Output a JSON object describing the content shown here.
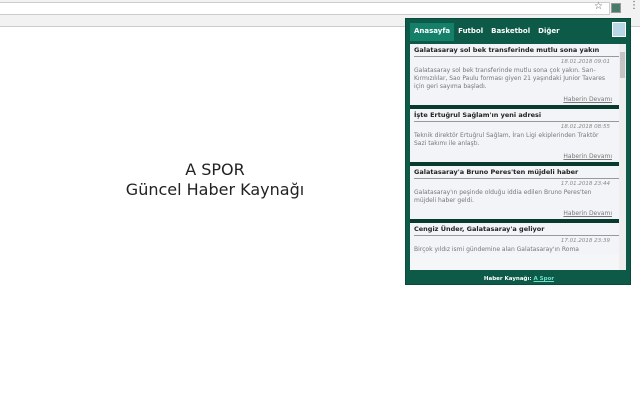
{
  "page": {
    "line1": "A SPOR",
    "line2": "Güncel Haber Kaynağı"
  },
  "popup": {
    "tabs": [
      "Anasayfa",
      "Futbol",
      "Basketbol",
      "Diğer"
    ],
    "articles": [
      {
        "title": "Galatasaray sol bek transferinde mutlu sona yakın",
        "date": "18.01.2018 09:01",
        "text": "Galatasaray sol bek transferinde mutlu sona çok yakın. Sarı-Kırmızılılar, Sao Paulu forması giyen 21 yaşındaki Junior Tavares için geri sayıma başladı.",
        "more": "Haberin Devamı"
      },
      {
        "title": "İşte Ertuğrul Sağlam'ın yeni adresi",
        "date": "18.01.2018 08:55",
        "text": "Teknik direktör Ertuğrul Sağlam, İran Ligi ekiplerinden Traktör Sazi takımı ile anlaştı.",
        "more": "Haberin Devamı"
      },
      {
        "title": "Galatasaray'a Bruno Peres'ten müjdeli haber",
        "date": "17.01.2018 23:44",
        "text": "Galatasaray'ın peşinde olduğu iddia edilen Bruno Peres'ten müjdeli haber geldi.",
        "more": "Haberin Devamı"
      },
      {
        "title": "Cengiz Ünder, Galatasaray'a geliyor",
        "date": "17.01.2018 23:39",
        "text": "Birçok yıldız ismi gündemine alan Galatasaray'ın Roma",
        "more": ""
      }
    ],
    "footer": {
      "label": "Haber Kaynağı:",
      "link": "A Spor"
    }
  }
}
